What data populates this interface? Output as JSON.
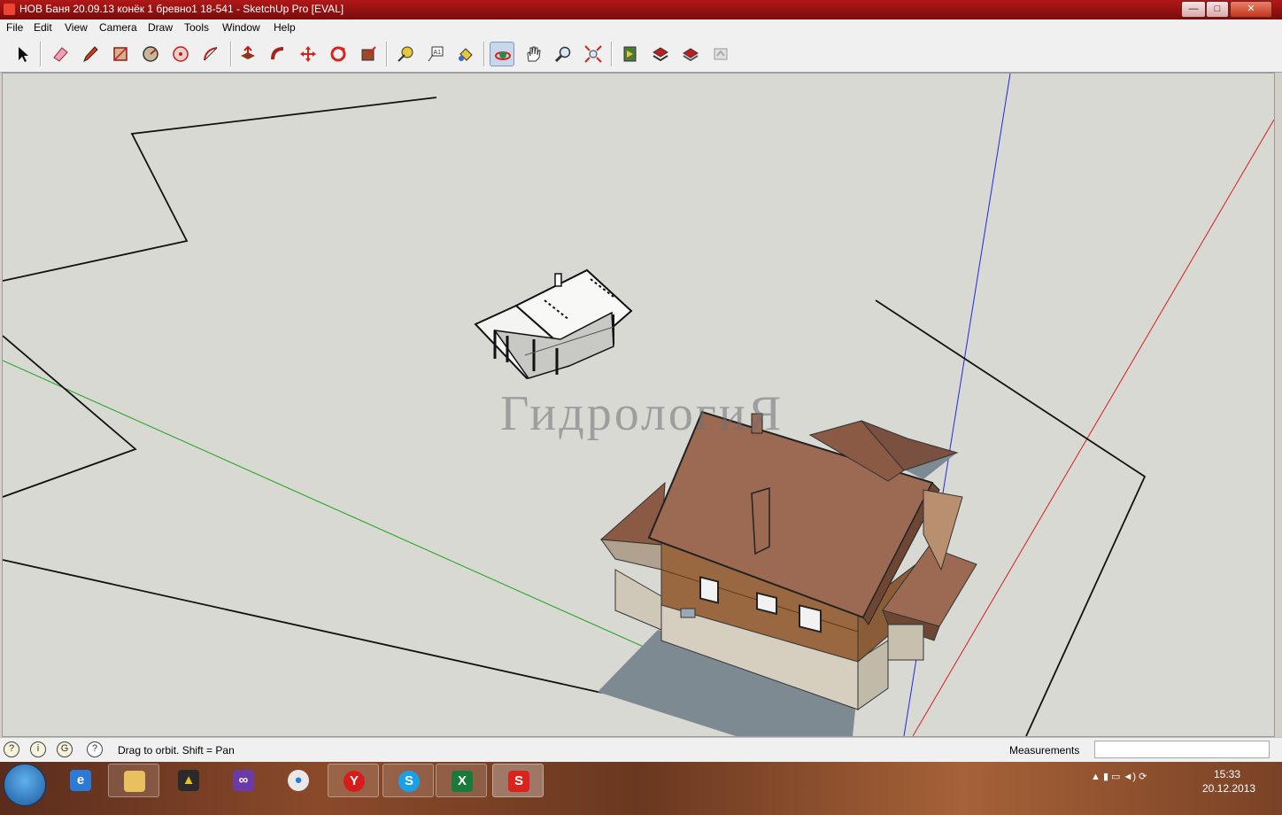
{
  "window": {
    "title": "НОВ Баня 20.09.13 конёк 1 бревно1 18-541 - SketchUp Pro [EVAL]",
    "minimize": "—",
    "maximize": "□",
    "close": "✕"
  },
  "menu": [
    "File",
    "Edit",
    "View",
    "Camera",
    "Draw",
    "Tools",
    "Window",
    "Help"
  ],
  "toolbar": {
    "tools": [
      "select-tool-icon",
      "eraser-tool-icon",
      "pencil-tool-icon",
      "rectangle-tool-icon",
      "circle-tool-icon",
      "arc-tool-icon",
      "polygon-tool-icon",
      "push-pull-tool-icon",
      "follow-me-tool-icon",
      "move-tool-icon",
      "rotate-tool-icon",
      "scale-tool-icon",
      "tape-measure-icon",
      "text-tool-icon",
      "paint-bucket-icon",
      "orbit-tool-icon",
      "pan-tool-icon",
      "zoom-tool-icon",
      "zoom-extents-icon",
      "previous-view-icon",
      "next-view-icon",
      "warehouse-icon",
      "share-model-icon"
    ],
    "active": "orbit-tool-icon"
  },
  "viewport": {
    "watermark": "ГидрологиЯ",
    "background": "#d9d9d4",
    "axis_colors": {
      "blue": "#1a2cd8",
      "red": "#d81c1c",
      "green": "#1aa61a"
    }
  },
  "status": {
    "icons": [
      "geo-location-icon",
      "credits-icon",
      "user-icon",
      "help-icon"
    ],
    "text": "Drag to orbit.  Shift = Pan",
    "measurements_label": "Measurements",
    "measurements_value": ""
  },
  "taskbar": {
    "apps": [
      "start-button",
      "ie-icon",
      "explorer-icon",
      "archicad-icon",
      "visual-studio-icon",
      "chrome-icon",
      "yandex-icon",
      "skype-icon",
      "excel-icon",
      "sketchup-icon"
    ],
    "clock_time": "15:33",
    "clock_date": "20.12.2013"
  }
}
